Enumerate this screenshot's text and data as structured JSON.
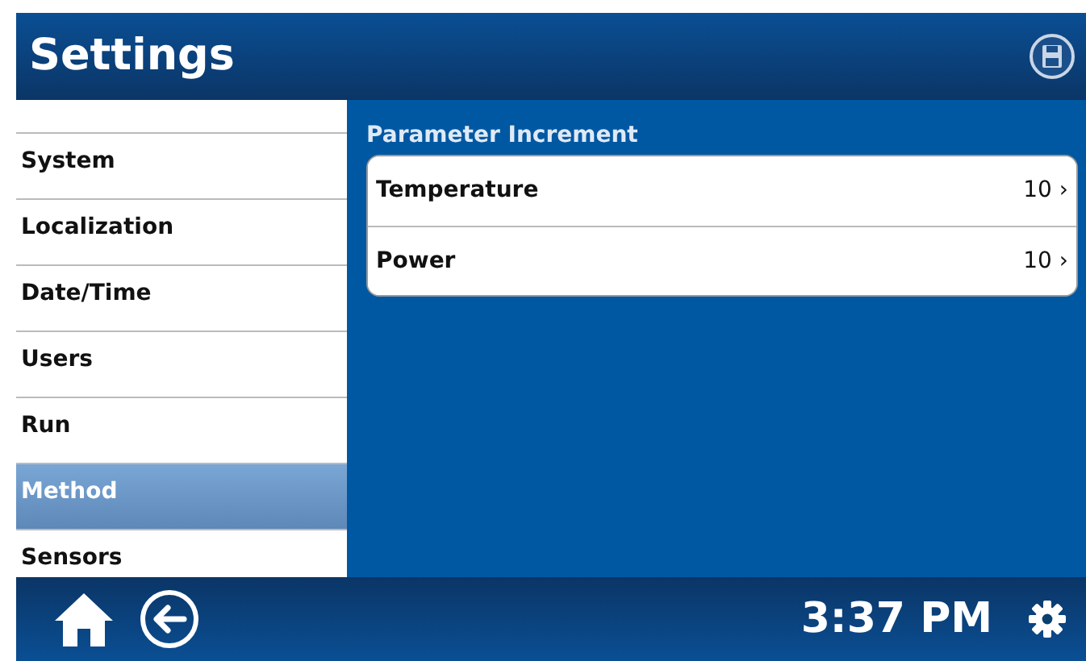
{
  "header": {
    "title": "Settings"
  },
  "sidebar": {
    "items": [
      {
        "label": "System",
        "selected": false
      },
      {
        "label": "Localization",
        "selected": false
      },
      {
        "label": "Date/Time",
        "selected": false
      },
      {
        "label": "Users",
        "selected": false
      },
      {
        "label": "Run",
        "selected": false
      },
      {
        "label": "Method",
        "selected": true
      },
      {
        "label": "Sensors",
        "selected": false
      }
    ]
  },
  "content": {
    "section_title": "Parameter Increment",
    "rows": [
      {
        "label": "Temperature",
        "value": "10",
        "chevron": "›"
      },
      {
        "label": "Power",
        "value": "10",
        "chevron": "›"
      }
    ]
  },
  "footer": {
    "time": "3:37 PM"
  }
}
